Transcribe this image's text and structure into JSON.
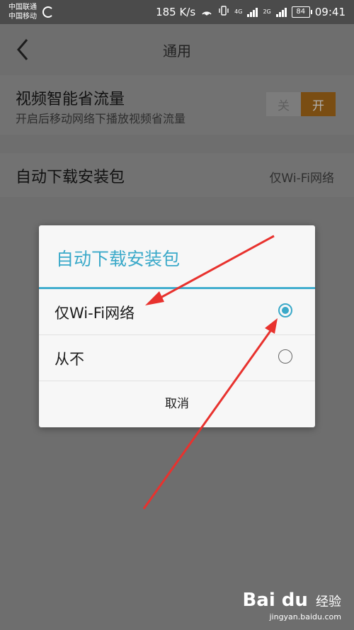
{
  "status_bar": {
    "carrier1": "中国联通",
    "carrier2": "中国移动",
    "net_speed": "185 K/s",
    "net_4g": "4G",
    "net_2g": "2G",
    "battery": "84",
    "time": "09:41"
  },
  "topbar": {
    "title": "通用"
  },
  "settings": {
    "video_saver": {
      "title": "视频智能省流量",
      "subtitle": "开启后移动网络下播放视频省流量",
      "toggle_off": "关",
      "toggle_on": "开",
      "enabled": true
    },
    "auto_download": {
      "title": "自动下载安装包",
      "value": "仅Wi-Fi网络"
    }
  },
  "dialog": {
    "title": "自动下载安装包",
    "options": [
      {
        "label": "仅Wi-Fi网络",
        "selected": true
      },
      {
        "label": "从不",
        "selected": false
      }
    ],
    "cancel": "取消"
  },
  "watermark": {
    "logo": "Bai du",
    "name": "经验",
    "domain": "jingyan.baidu.com"
  },
  "colors": {
    "accent": "#3aa9c9",
    "annotation_arrow": "#e8322e",
    "toggle_on_bg": "#7a4d12"
  }
}
